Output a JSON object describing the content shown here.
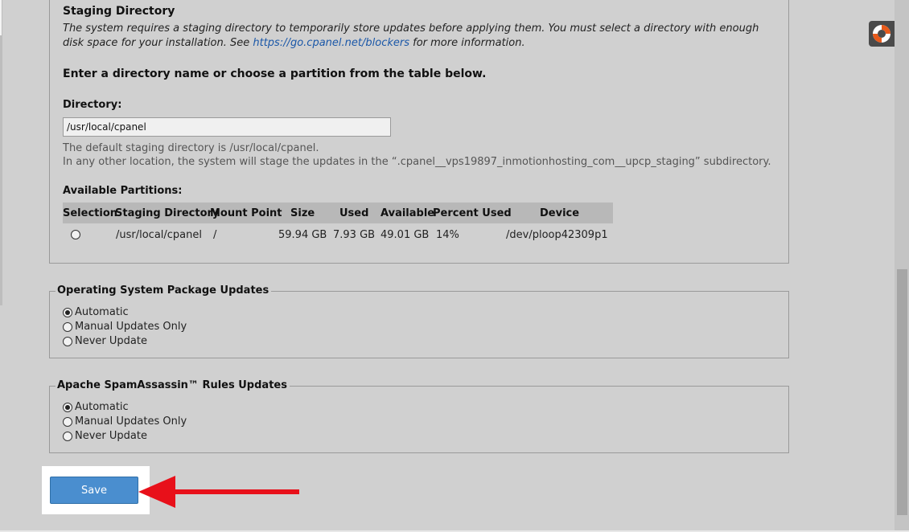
{
  "staging": {
    "title": "Staging Directory",
    "desc_pre": "The system requires a staging directory to temporarily store updates before applying them. You must select a directory with enough disk space for your installation. See ",
    "desc_link": "https://go.cpanel.net/blockers",
    "desc_post": " for more information.",
    "instruction": "Enter a directory name or choose a partition from the table below.",
    "directory_label": "Directory:",
    "directory_value": "/usr/local/cpanel",
    "hint_line1": "The default staging directory is /usr/local/cpanel.",
    "hint_line2": "In any other location, the system will stage the updates in the “.cpanel__vps19897_inmotionhosting_com__upcp_staging” subdirectory.",
    "partitions_label": "Available Partitions:",
    "columns": {
      "selection": "Selection",
      "staging_dir": "Staging Directory",
      "mount_point": "Mount Point",
      "size": "Size",
      "used": "Used",
      "available": "Available",
      "percent_used": "Percent Used",
      "device": "Device"
    },
    "rows": [
      {
        "staging_dir": "/usr/local/cpanel",
        "mount_point": "/",
        "size": "59.94 GB",
        "used": "7.93 GB",
        "available": "49.01 GB",
        "percent_used": "14%",
        "device": "/dev/ploop42309p1"
      }
    ]
  },
  "os_updates": {
    "legend": "Operating System Package Updates",
    "options": [
      "Automatic",
      "Manual Updates Only",
      "Never Update"
    ],
    "selected": "Automatic"
  },
  "spam_updates": {
    "legend": "Apache SpamAssassin™ Rules Updates",
    "options": [
      "Automatic",
      "Manual Updates Only",
      "Never Update"
    ],
    "selected": "Automatic"
  },
  "save_label": "Save",
  "icons": {
    "help": "lifebuoy-icon",
    "annotation": "red-arrow-icon"
  },
  "colors": {
    "background": "#d0d0d0",
    "save_button": "#4a8ecf",
    "link": "#1a57a8",
    "arrow": "#e8101a"
  }
}
